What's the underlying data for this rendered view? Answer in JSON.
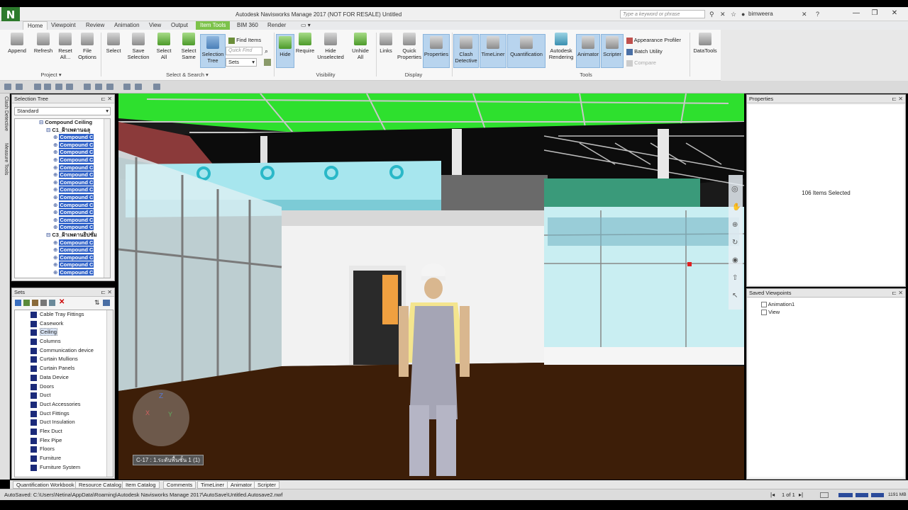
{
  "titlebar": {
    "logo": "N",
    "title": "Autodesk Navisworks Manage 2017 (NOT FOR RESALE)   Untitled",
    "search_placeholder": "Type a keyword or phrase",
    "user": "bimweera",
    "window_controls": [
      "minimize-icon",
      "restore-icon",
      "close-icon"
    ]
  },
  "tabs": [
    "Home",
    "Viewpoint",
    "Review",
    "Animation",
    "View",
    "Output",
    "Item Tools",
    "BIM 360",
    "Render"
  ],
  "active_tab": "Home",
  "contextual_tab": "Item Tools",
  "ribbon": {
    "project": {
      "buttons": [
        "Append",
        "Refresh",
        "Reset All...",
        "File Options"
      ],
      "label": "Project ▾"
    },
    "select_search": {
      "buttons": [
        "Select",
        "Save Selection",
        "Select All",
        "Select Same",
        "Selection Tree"
      ],
      "find_items": "Find Items",
      "quick_find_placeholder": "Quick Find",
      "sets_value": "Sets",
      "label": "Select & Search ▾"
    },
    "visibility": {
      "buttons": [
        "Hide",
        "Require",
        "Hide Unselected",
        "Unhide All"
      ],
      "label": "Visibility"
    },
    "display": {
      "buttons": [
        "Links",
        "Quick Properties",
        "Properties"
      ],
      "label": "Display"
    },
    "tools": {
      "buttons": [
        "Clash Detective",
        "TimeLiner",
        "Quantification",
        "Autodesk Rendering",
        "Animator",
        "Scripter"
      ],
      "small": [
        "Appearance Profiler",
        "Batch Utility",
        "Compare"
      ],
      "label": "Tools"
    },
    "datatools": "DataTools"
  },
  "left_strip": [
    "Clash Detective",
    "Measure Tools"
  ],
  "selection_tree": {
    "title": "Selection Tree",
    "mode": "Standard",
    "rows": [
      {
        "indent": 3,
        "text": "Compound Ceiling",
        "highlight": false,
        "bold": true
      },
      {
        "indent": 4,
        "text": "C1_ฝ้าเพดานฉลุ",
        "highlight": false,
        "bold": true
      },
      {
        "indent": 5,
        "text": "Compound C",
        "highlight": true
      },
      {
        "indent": 5,
        "text": "Compound C",
        "highlight": true
      },
      {
        "indent": 5,
        "text": "Compound C",
        "highlight": true
      },
      {
        "indent": 5,
        "text": "Compound C",
        "highlight": true
      },
      {
        "indent": 5,
        "text": "Compound C",
        "highlight": true
      },
      {
        "indent": 5,
        "text": "Compound C",
        "highlight": true
      },
      {
        "indent": 5,
        "text": "Compound C",
        "highlight": true
      },
      {
        "indent": 5,
        "text": "Compound C",
        "highlight": true
      },
      {
        "indent": 5,
        "text": "Compound C",
        "highlight": true
      },
      {
        "indent": 5,
        "text": "Compound C",
        "highlight": true
      },
      {
        "indent": 5,
        "text": "Compound C",
        "highlight": true
      },
      {
        "indent": 5,
        "text": "Compound C",
        "highlight": true
      },
      {
        "indent": 5,
        "text": "Compound C",
        "highlight": true
      },
      {
        "indent": 4,
        "text": "C3_ฝ้าเพดานยิปซั่ม",
        "highlight": false,
        "bold": true
      },
      {
        "indent": 5,
        "text": "Compound C",
        "highlight": true
      },
      {
        "indent": 5,
        "text": "Compound C",
        "highlight": true
      },
      {
        "indent": 5,
        "text": "Compound C",
        "highlight": true
      },
      {
        "indent": 5,
        "text": "Compound C",
        "highlight": true
      },
      {
        "indent": 5,
        "text": "Compound C",
        "highlight": true
      }
    ]
  },
  "sets": {
    "title": "Sets",
    "items": [
      "Cable Tray Fittings",
      "Casework",
      "Ceiling",
      "Columns",
      "Communication device",
      "Curtain Mullions",
      "Curtain Panels",
      "Data Device",
      "Doors",
      "Duct",
      "Duct Accessories",
      "Duct Fittings",
      "Duct Insulation",
      "Flex Duct",
      "Flex Pipe",
      "Floors",
      "Furniture",
      "Furniture System"
    ],
    "selected": "Ceiling"
  },
  "viewport": {
    "grid_label": "C-17 : 1.ระดับพื้นชั้น 1 (1)",
    "axis_z": "Z",
    "axis_x": "X",
    "axis_y": "Y"
  },
  "properties": {
    "title": "Properties",
    "message": "106 Items Selected"
  },
  "saved_viewpoints": {
    "title": "Saved Viewpoints",
    "items": [
      "Animation1",
      "View"
    ]
  },
  "bottom_tabs": [
    "Quantification Workbook",
    "Resource Catalog",
    "Item Catalog",
    "Comments",
    "TimeLiner",
    "Animator",
    "Scripter"
  ],
  "status": {
    "autosave": "AutoSaved: C:\\Users\\Netina\\AppData\\Roaming\\Autodesk Navisworks Manage 2017\\AutoSave\\Untitled.Autosave2.nwf",
    "page": "1 of 1",
    "memory": "1191 MB"
  }
}
